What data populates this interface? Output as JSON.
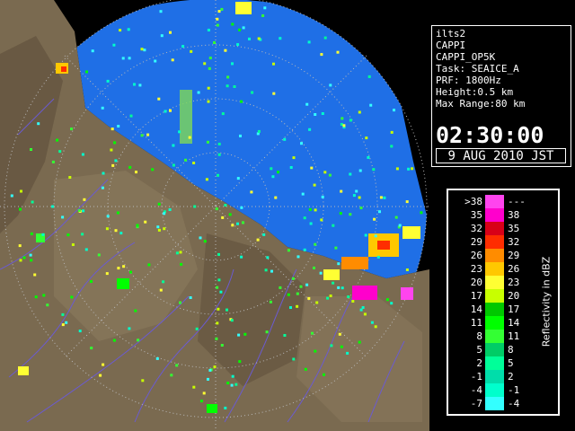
{
  "info": {
    "lines": [
      "ilts2",
      "CAPPI",
      "CAPPI_OP5K",
      "Task: SEAICE_A",
      "PRF: 1800Hz",
      "Height:0.5 km",
      "Max Range:80 km"
    ],
    "time": "02:30:00",
    "date": "9 AUG 2010 JST"
  },
  "legend": {
    "title": "Reflectivity in dBZ",
    "rows": [
      {
        "low": ">38",
        "high": "---",
        "color": "#ff44ee"
      },
      {
        "low": "35",
        "high": "38",
        "color": "#ff00cc"
      },
      {
        "low": "32",
        "high": "35",
        "color": "#d80018"
      },
      {
        "low": "29",
        "high": "32",
        "color": "#ff2d00"
      },
      {
        "low": "26",
        "high": "29",
        "color": "#ff8c00"
      },
      {
        "low": "23",
        "high": "26",
        "color": "#ffc800"
      },
      {
        "low": "20",
        "high": "23",
        "color": "#ffff33"
      },
      {
        "low": "17",
        "high": "20",
        "color": "#c8ff00"
      },
      {
        "low": "14",
        "high": "17",
        "color": "#00c800"
      },
      {
        "low": "11",
        "high": "14",
        "color": "#00ff00"
      },
      {
        "low": "8",
        "high": "11",
        "color": "#33ff33"
      },
      {
        "low": "5",
        "high": "8",
        "color": "#00cc66"
      },
      {
        "low": "2",
        "high": "5",
        "color": "#00ff99"
      },
      {
        "low": "-1",
        "high": "2",
        "color": "#00ddaa"
      },
      {
        "low": "-4",
        "high": "-1",
        "color": "#00ffcc"
      },
      {
        "low": "-7",
        "high": "-4",
        "color": "#33ffff"
      }
    ]
  },
  "colors": {
    "sea": "#1f6fe6",
    "land": "#7a6a50",
    "range_ring": "#b8b8b8",
    "river": "#6b5bd0"
  }
}
